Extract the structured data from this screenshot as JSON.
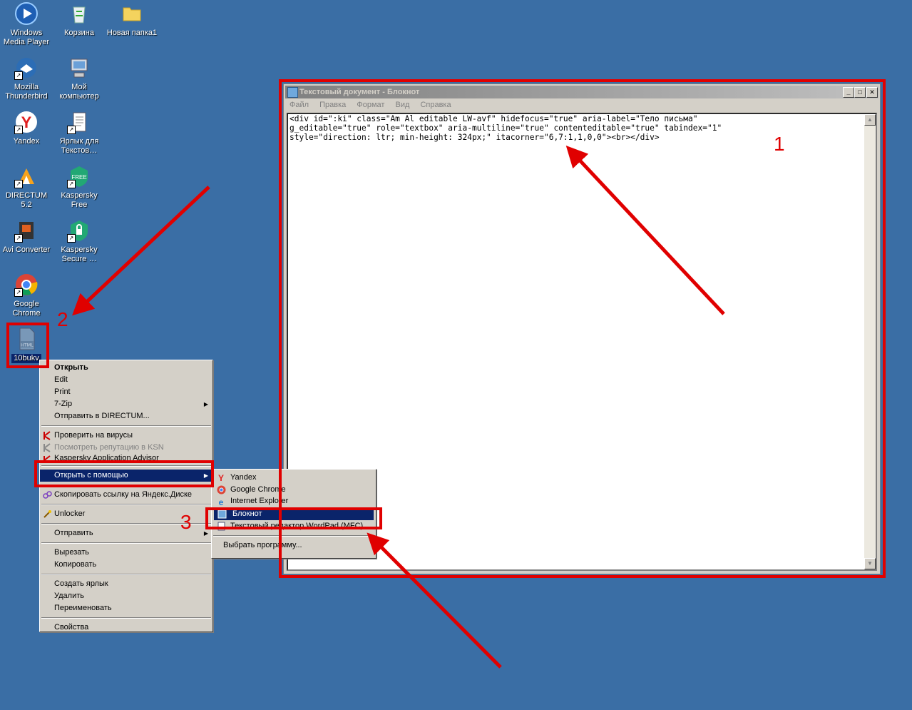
{
  "desktop": {
    "icons": [
      {
        "label": "Windows Media Player",
        "icon": "media-player-icon"
      },
      {
        "label": "Корзина",
        "icon": "recycle-bin-icon"
      },
      {
        "label": "Новая папка1",
        "icon": "folder-icon"
      },
      {
        "label": "Mozilla Thunderbird",
        "icon": "thunderbird-icon"
      },
      {
        "label": "Мой компьютер",
        "icon": "computer-icon"
      },
      {
        "label": "Yandex",
        "icon": "yandex-icon"
      },
      {
        "label": "Ярлык для Текстов…",
        "icon": "notepad-doc-icon"
      },
      {
        "label": "DIRECTUM 5.2",
        "icon": "directum-icon"
      },
      {
        "label": "Kaspersky Free",
        "icon": "kaspersky-free-icon"
      },
      {
        "label": "Avi Converter",
        "icon": "avi-converter-icon"
      },
      {
        "label": "Kaspersky Secure …",
        "icon": "kaspersky-secure-icon"
      },
      {
        "label": "Google Chrome",
        "icon": "chrome-icon"
      },
      {
        "label": "10bukv",
        "icon": "html-file-icon",
        "badge": "HTML"
      }
    ]
  },
  "notepad": {
    "title": "Текстовый документ - Блокнот",
    "menu": [
      "Файл",
      "Правка",
      "Формат",
      "Вид",
      "Справка"
    ],
    "content": "<div id=\":ki\" class=\"Am Al editable LW-avf\" hidefocus=\"true\" aria-label=\"Тело письма\"\ng_editable=\"true\" role=\"textbox\" aria-multiline=\"true\" contenteditable=\"true\" tabindex=\"1\"\nstyle=\"direction: ltr; min-height: 324px;\" itacorner=\"6,7:1,1,0,0\"><br></div>",
    "buttons": {
      "minimize": "_",
      "maximize": "□",
      "close": "✕"
    }
  },
  "context_menu": {
    "items": [
      {
        "label": "Открыть",
        "bold": true
      },
      {
        "label": "Edit"
      },
      {
        "label": "Print"
      },
      {
        "label": "7-Zip",
        "submenu": true
      },
      {
        "label": "Отправить в DIRECTUM..."
      },
      {
        "label": "Проверить на вирусы"
      },
      {
        "label": "Посмотреть репутацию в KSN"
      },
      {
        "label": "Kaspersky Application Advisor"
      },
      {
        "label": "Открыть с помощью",
        "submenu": true
      },
      {
        "label": "Скопировать ссылку на Яндекс.Диске"
      },
      {
        "label": "Unlocker"
      },
      {
        "label": "Отправить",
        "submenu": true
      },
      {
        "label": "Вырезать"
      },
      {
        "label": "Копировать"
      },
      {
        "label": "Создать ярлык"
      },
      {
        "label": "Удалить"
      },
      {
        "label": "Переименовать"
      },
      {
        "label": "Свойства"
      }
    ]
  },
  "open_with_menu": {
    "items": [
      {
        "label": "Yandex"
      },
      {
        "label": "Google Chrome"
      },
      {
        "label": "Internet Explorer"
      },
      {
        "label": "Блокнот"
      },
      {
        "label": "Текстовый редактор WordPad (MFC)"
      },
      {
        "label": "Выбрать программу..."
      }
    ]
  },
  "annotations": {
    "n1": "1",
    "n2": "2",
    "n3": "3"
  },
  "colors": {
    "desktop": "#3a6ea5",
    "annotation": "#e00000",
    "selection": "#0a246a"
  }
}
